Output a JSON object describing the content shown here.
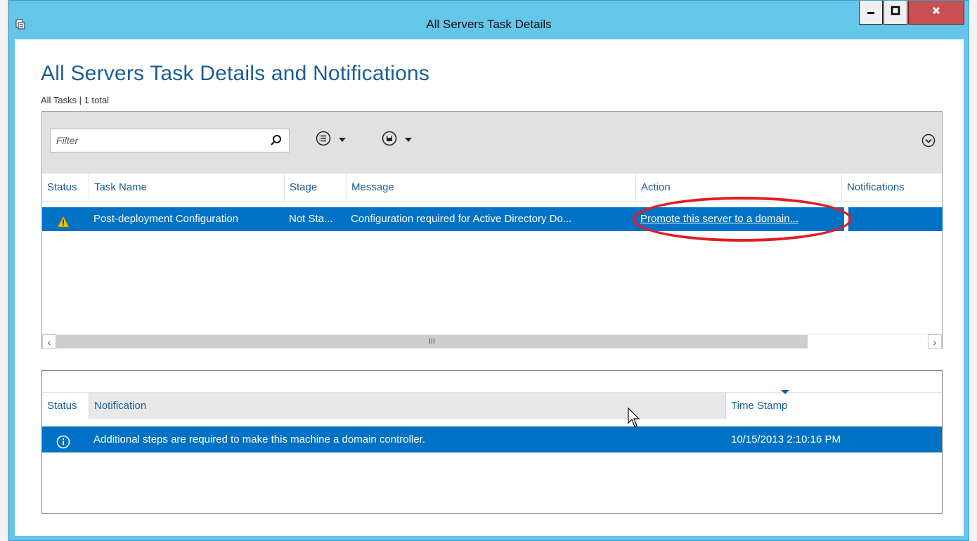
{
  "window": {
    "title": "All Servers Task Details"
  },
  "page": {
    "title": "All Servers Task Details and Notifications",
    "subtitle": "All Tasks | 1 total"
  },
  "toolbar": {
    "filter_placeholder": "Filter"
  },
  "tasks": {
    "columns": [
      "Status",
      "Task Name",
      "Stage",
      "Message",
      "Action",
      "Notifications"
    ],
    "rows": [
      {
        "status_icon": "warning-icon",
        "task_name": "Post-deployment Configuration",
        "stage": "Not Sta...",
        "message": "Configuration required for Active Directory Do...",
        "action": "Promote this server to a domain...",
        "notifications": ""
      }
    ],
    "scrollbar_label": "III"
  },
  "notifications": {
    "columns": [
      "Status",
      "Notification",
      "Time Stamp"
    ],
    "rows": [
      {
        "status_icon": "info-icon",
        "notification": "Additional steps are required to make this machine a domain controller.",
        "time_stamp": "10/15/2013 2:10:16 PM"
      }
    ]
  },
  "colors": {
    "accent": "#0072c6",
    "title_blue": "#1b5e96",
    "window_frame": "#65c6ea",
    "highlight": "#e31b23"
  }
}
